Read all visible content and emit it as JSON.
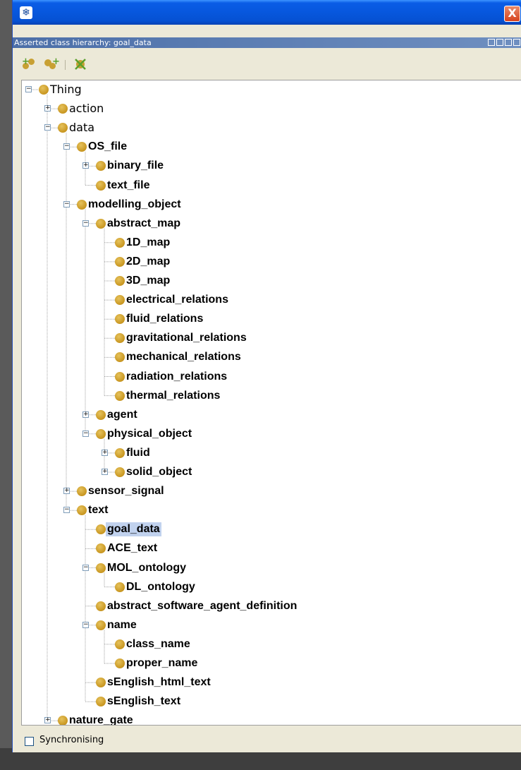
{
  "window": {
    "app_icon": "protege-icon",
    "close_label": "X"
  },
  "view": {
    "title": "Asserted class hierarchy: goal_data"
  },
  "toolbar": {
    "buttons": [
      {
        "name": "add-subclass-button",
        "icon": "add-subclass-icon"
      },
      {
        "name": "add-sibling-button",
        "icon": "add-sibling-icon"
      },
      {
        "name": "delete-class-button",
        "icon": "delete-class-icon"
      }
    ]
  },
  "tree": {
    "selected": "goal_data",
    "rows": [
      {
        "label": "Thing",
        "depth": 0,
        "expander": "minus",
        "bold": false
      },
      {
        "label": "action",
        "depth": 1,
        "expander": "plus",
        "bold": false
      },
      {
        "label": "data",
        "depth": 1,
        "expander": "minus",
        "bold": false
      },
      {
        "label": "OS_file",
        "depth": 2,
        "expander": "minus",
        "bold": true
      },
      {
        "label": "binary_file",
        "depth": 3,
        "expander": "plus",
        "bold": true
      },
      {
        "label": "text_file",
        "depth": 3,
        "expander": "none",
        "bold": true
      },
      {
        "label": "modelling_object",
        "depth": 2,
        "expander": "minus",
        "bold": true
      },
      {
        "label": "abstract_map",
        "depth": 3,
        "expander": "minus",
        "bold": true
      },
      {
        "label": "1D_map",
        "depth": 4,
        "expander": "none",
        "bold": true
      },
      {
        "label": "2D_map",
        "depth": 4,
        "expander": "none",
        "bold": true
      },
      {
        "label": "3D_map",
        "depth": 4,
        "expander": "none",
        "bold": true
      },
      {
        "label": "electrical_relations",
        "depth": 4,
        "expander": "none",
        "bold": true
      },
      {
        "label": "fluid_relations",
        "depth": 4,
        "expander": "none",
        "bold": true
      },
      {
        "label": "gravitational_relations",
        "depth": 4,
        "expander": "none",
        "bold": true
      },
      {
        "label": "mechanical_relations",
        "depth": 4,
        "expander": "none",
        "bold": true
      },
      {
        "label": "radiation_relations",
        "depth": 4,
        "expander": "none",
        "bold": true
      },
      {
        "label": "thermal_relations",
        "depth": 4,
        "expander": "none",
        "bold": true
      },
      {
        "label": "agent",
        "depth": 3,
        "expander": "plus",
        "bold": true
      },
      {
        "label": "physical_object",
        "depth": 3,
        "expander": "minus",
        "bold": true
      },
      {
        "label": "fluid",
        "depth": 4,
        "expander": "plus",
        "bold": true
      },
      {
        "label": "solid_object",
        "depth": 4,
        "expander": "plus",
        "bold": true
      },
      {
        "label": "sensor_signal",
        "depth": 2,
        "expander": "plus",
        "bold": true
      },
      {
        "label": "text",
        "depth": 2,
        "expander": "minus",
        "bold": true
      },
      {
        "label": "goal_data",
        "depth": 3,
        "expander": "none",
        "bold": true
      },
      {
        "label": "ACE_text",
        "depth": 3,
        "expander": "none",
        "bold": true
      },
      {
        "label": "MOL_ontology",
        "depth": 3,
        "expander": "minus",
        "bold": true
      },
      {
        "label": "DL_ontology",
        "depth": 4,
        "expander": "none",
        "bold": true
      },
      {
        "label": "abstract_software_agent_definition",
        "depth": 3,
        "expander": "none",
        "bold": true
      },
      {
        "label": "name",
        "depth": 3,
        "expander": "minus",
        "bold": true
      },
      {
        "label": "class_name",
        "depth": 4,
        "expander": "none",
        "bold": true
      },
      {
        "label": "proper_name",
        "depth": 4,
        "expander": "none",
        "bold": true
      },
      {
        "label": "sEnglish_html_text",
        "depth": 3,
        "expander": "none",
        "bold": true
      },
      {
        "label": "sEnglish_text",
        "depth": 3,
        "expander": "none",
        "bold": true
      },
      {
        "label": "nature_gate",
        "depth": 1,
        "expander": "plus",
        "bold": true
      }
    ]
  },
  "status": {
    "synchronising_label": "Synchronising",
    "synchronising_checked": false
  }
}
